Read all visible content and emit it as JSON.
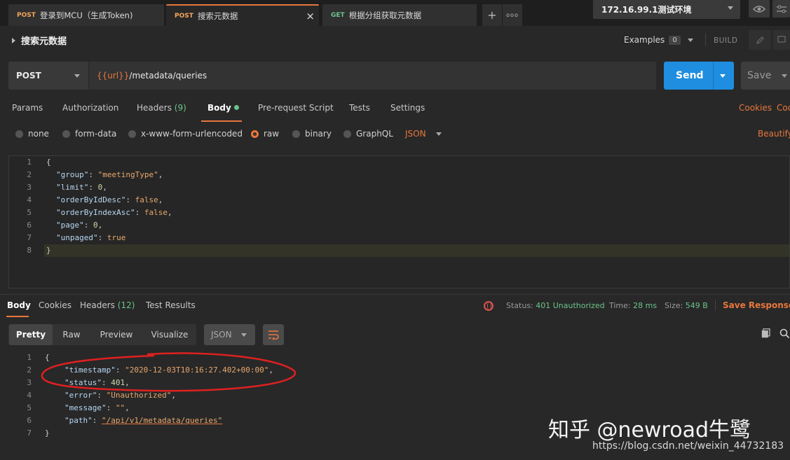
{
  "tabs": [
    {
      "method": "POST",
      "title": "登录到MCU（生成Token)"
    },
    {
      "method": "POST",
      "title": "搜索元数据",
      "active": true
    },
    {
      "method": "GET",
      "title": "根据分组获取元数据"
    }
  ],
  "tab_actions": {
    "add": "+",
    "more": "ooo"
  },
  "environment": {
    "name": "172.16.99.1测试环境"
  },
  "icons": [
    "eye-icon",
    "sliders-icon",
    "close-icon",
    "caret-icon",
    "pencil-icon",
    "comment-icon",
    "globe-icon",
    "copy-icon",
    "search-icon",
    "wrap-icon"
  ],
  "request": {
    "title": "搜索元数据",
    "examples_label": "Examples",
    "examples_count": "0",
    "build_label": "BUILD",
    "method": "POST",
    "url_var": "{{url}}",
    "url_path": "/metadata/queries",
    "send_label": "Send",
    "save_label": "Save"
  },
  "request_tabs": {
    "params": "Params",
    "authorization": "Authorization",
    "headers": "Headers",
    "headers_count": "(9)",
    "body": "Body",
    "pre_request": "Pre-request Script",
    "tests": "Tests",
    "settings": "Settings",
    "cookies": "Cookies",
    "code": "Code"
  },
  "body_types": {
    "none": "none",
    "form_data": "form-data",
    "urlencoded": "x-www-form-urlencoded",
    "raw": "raw",
    "binary": "binary",
    "graphql": "GraphQL",
    "format": "JSON",
    "beautify": "Beautify"
  },
  "request_body": {
    "line_numbers": [
      "1",
      "2",
      "3",
      "4",
      "5",
      "6",
      "7",
      "8"
    ],
    "open_brace": "{",
    "close_brace": "}",
    "fields": [
      {
        "key": "\"group\"",
        "value": "\"meetingType\"",
        "kind": "s",
        "comma": ","
      },
      {
        "key": "\"limit\"",
        "value": "0",
        "kind": "n",
        "comma": ","
      },
      {
        "key": "\"orderByIdDesc\"",
        "value": "false",
        "kind": "b",
        "comma": ","
      },
      {
        "key": "\"orderByIndexAsc\"",
        "value": "false",
        "kind": "b",
        "comma": ","
      },
      {
        "key": "\"page\"",
        "value": "0",
        "kind": "n",
        "comma": ","
      },
      {
        "key": "\"unpaged\"",
        "value": "true",
        "kind": "b",
        "comma": ""
      }
    ]
  },
  "response_tabs": {
    "body": "Body",
    "cookies": "Cookies",
    "headers": "Headers",
    "headers_count": "(12)",
    "test_results": "Test Results"
  },
  "response_status": {
    "status_label": "Status:",
    "status_value": "401 Unauthorized",
    "time_label": "Time:",
    "time_value": "28 ms",
    "size_label": "Size:",
    "size_value": "549 B",
    "save_response": "Save Response"
  },
  "response_view": {
    "pretty": "Pretty",
    "raw": "Raw",
    "preview": "Preview",
    "visualize": "Visualize",
    "format": "JSON"
  },
  "response_body": {
    "line_numbers": [
      "1",
      "2",
      "3",
      "4",
      "5",
      "6",
      "7"
    ],
    "open_brace": "{",
    "close_brace": "}",
    "fields": [
      {
        "key": "\"timestamp\"",
        "value": "\"2020-12-03T10:16:27.402+00:00\"",
        "kind": "s",
        "comma": ","
      },
      {
        "key": "\"status\"",
        "value": "401",
        "kind": "n",
        "comma": ","
      },
      {
        "key": "\"error\"",
        "value": "\"Unauthorized\"",
        "kind": "s",
        "comma": ","
      },
      {
        "key": "\"message\"",
        "value": "\"\"",
        "kind": "s",
        "comma": ","
      },
      {
        "key": "\"path\"",
        "value": "\"/api/v1/metadata/queries\"",
        "kind": "s",
        "comma": ""
      }
    ]
  },
  "watermark": {
    "brand": "知乎 @newroad牛鹭",
    "url": "https://blog.csdn.net/weixin_44732183"
  },
  "colors": {
    "accent": "#e8773c",
    "send": "#1f8ee0",
    "success": "#6bc48a",
    "annotation": "#e02020"
  }
}
